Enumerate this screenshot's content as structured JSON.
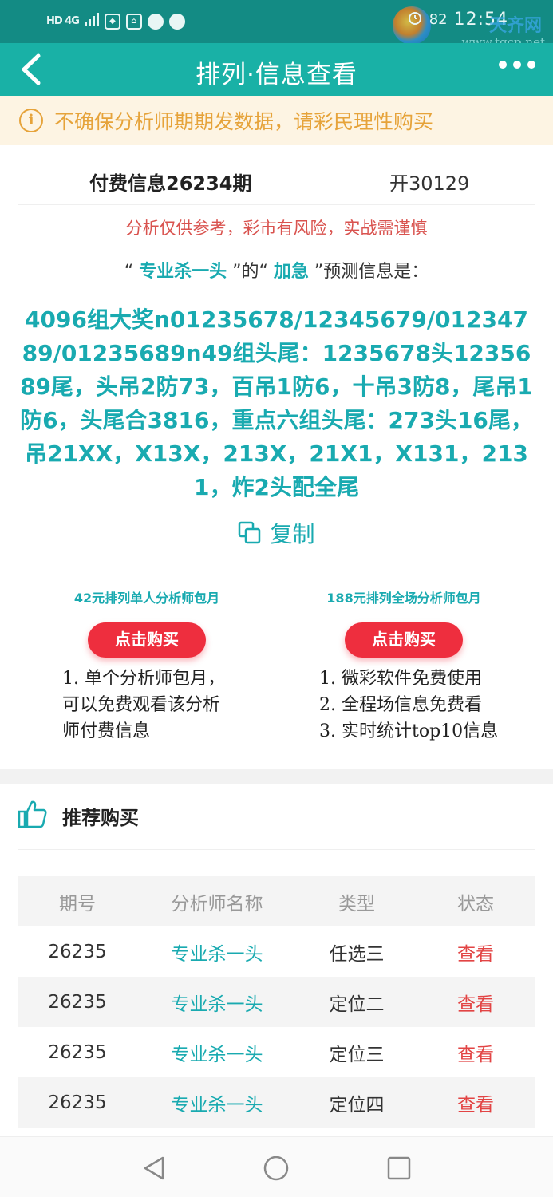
{
  "status_bar": {
    "left_text": "HD 4G",
    "battery_text": "82",
    "time": "12:54",
    "watermark_brand": "天齐网",
    "watermark_url": "www.tqcp.net"
  },
  "app_bar": {
    "title": "排列·信息查看"
  },
  "notice": {
    "text": "不确保分析师期期发数据，请彩民理性购买"
  },
  "info": {
    "issue": "付费信息26234期",
    "open": "开30129",
    "risk": "分析仅供参考，彩市有风险，实战需谨慎",
    "pred_prefix": "“ ",
    "analyst": "专业杀一头",
    "pred_mid": " ”的“ ",
    "type": "加急",
    "pred_suffix": " ”预测信息是：",
    "prediction": "4096组大奖n01235678/12345679/01234789/01235689n49组头尾：1235678头1235689尾，头吊2防73，百吊1防6，十吊3防8，尾吊1防6，头尾合3816，重点六组头尾：273头16尾，吊21XX，X13X，213X，21X1，X131，2131，炸2头配全尾",
    "copy_label": "复制"
  },
  "packages": [
    {
      "title": "42元排列单人分析师包月",
      "button": "点击购买",
      "lines": [
        "1. 单个分析师包月，",
        "可以免费观看该分析",
        "师付费信息"
      ]
    },
    {
      "title": "188元排列全场分析师包月",
      "button": "点击购买",
      "lines": [
        "1. 微彩软件免费使用",
        "2. 全程场信息免费看",
        "3. 实时统计top10信息"
      ]
    }
  ],
  "recommend": {
    "title": "推荐购买",
    "columns": [
      "期号",
      "分析师名称",
      "类型",
      "状态"
    ],
    "rows": [
      {
        "issue": "26235",
        "analyst": "专业杀一头",
        "type": "任选三",
        "status": "查看"
      },
      {
        "issue": "26235",
        "analyst": "专业杀一头",
        "type": "定位二",
        "status": "查看"
      },
      {
        "issue": "26235",
        "analyst": "专业杀一头",
        "type": "定位三",
        "status": "查看"
      },
      {
        "issue": "26235",
        "analyst": "专业杀一头",
        "type": "定位四",
        "status": "查看"
      }
    ]
  },
  "colors": {
    "primary": "#19b1a6",
    "status_bar": "#138b84",
    "accent_text": "#19aab0",
    "warning": "#e6a33a",
    "notice_bg": "#fdf4e3",
    "danger": "#ee2e3e"
  }
}
